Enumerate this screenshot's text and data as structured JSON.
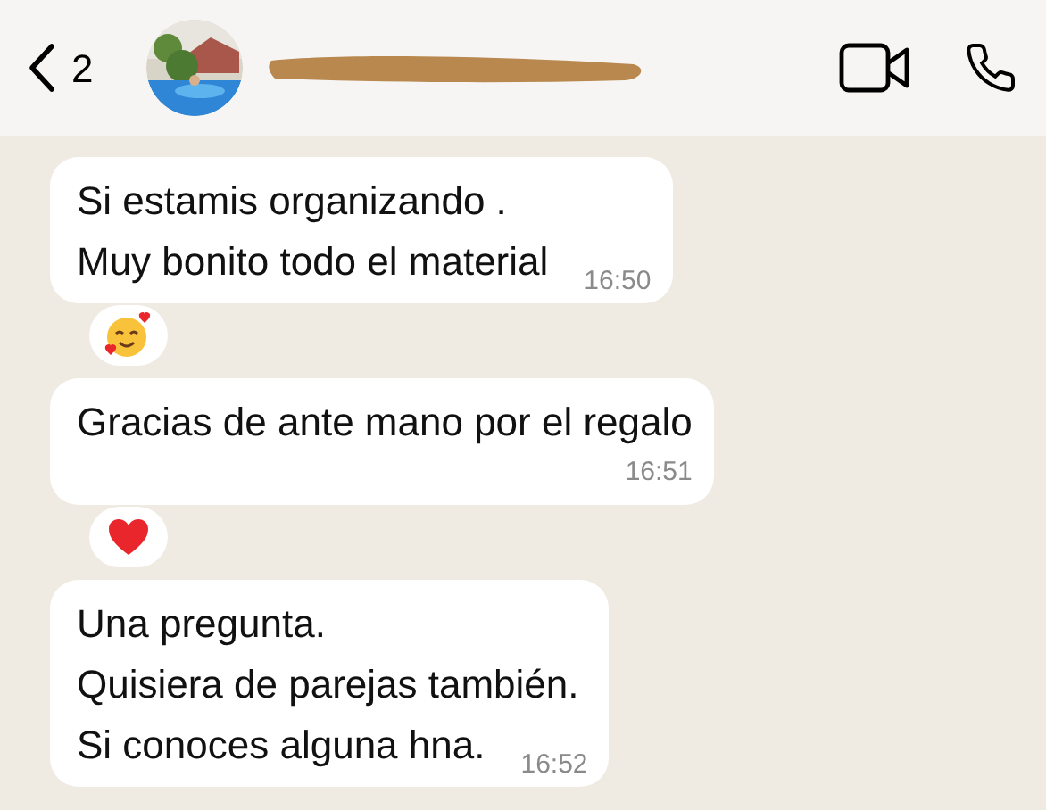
{
  "header": {
    "back_count": "2"
  },
  "messages": [
    {
      "lines": [
        "Si estamis organizando .",
        "Muy bonito todo el material"
      ],
      "time": "16:50",
      "reaction": {
        "kind": "smiling_hearts"
      }
    },
    {
      "lines": [
        "Gracias de ante mano por el regalo"
      ],
      "time": "16:51",
      "reaction": {
        "kind": "heart"
      }
    },
    {
      "lines": [
        "Una pregunta.",
        "Quisiera de parejas también.",
        "Si conoces alguna hna."
      ],
      "time": "16:52"
    }
  ]
}
